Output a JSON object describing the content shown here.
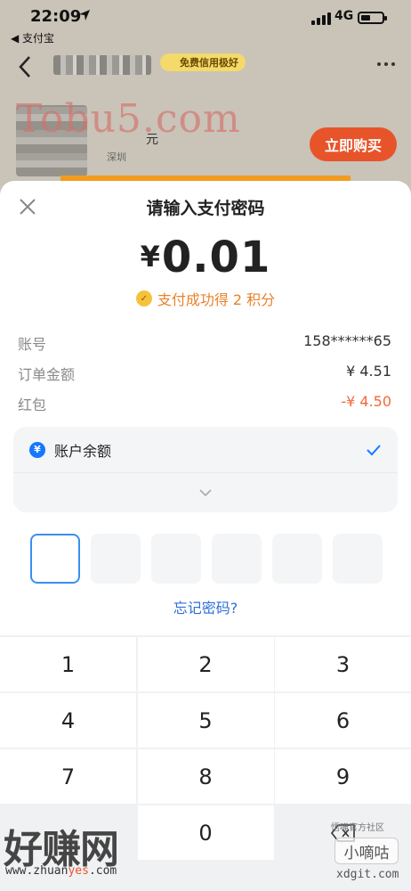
{
  "status_bar": {
    "time": "22:09",
    "back_app": "◀ 支付宝",
    "network": "4G"
  },
  "background_page": {
    "credit_badge": "免费信用极好",
    "watermark": "Tobu5.com",
    "price_unit": "元",
    "location": "深圳",
    "buy_button": "立即购买"
  },
  "sheet": {
    "title": "请输入支付密码",
    "amount_currency": "¥",
    "amount_value": "0.01",
    "points_text": "支付成功得 2 积分",
    "rows": [
      {
        "label": "账号",
        "value": "158******65"
      },
      {
        "label": "订单金额",
        "value": "¥ 4.51"
      },
      {
        "label": "红包",
        "value": "-¥ 4.50"
      }
    ],
    "method": {
      "label": "账户余额",
      "icon_char": "¥"
    },
    "forgot_password": "忘记密码?",
    "keypad": [
      "1",
      "2",
      "3",
      "4",
      "5",
      "6",
      "7",
      "8",
      "9",
      "0"
    ]
  },
  "overlay_watermarks": {
    "site_brand": "好赚网",
    "site_url_pre": "www.zhuan",
    "site_url_mid": "yes",
    "site_url_post": ".com",
    "corner_top": "悟喵官方社区",
    "corner_brand": "小嘀咕",
    "corner_url": "xdgit.com"
  },
  "colors": {
    "accent_blue": "#1677ff",
    "orange": "#e8542a",
    "red_text": "#f06a3a",
    "link_blue": "#2f6fd6"
  }
}
